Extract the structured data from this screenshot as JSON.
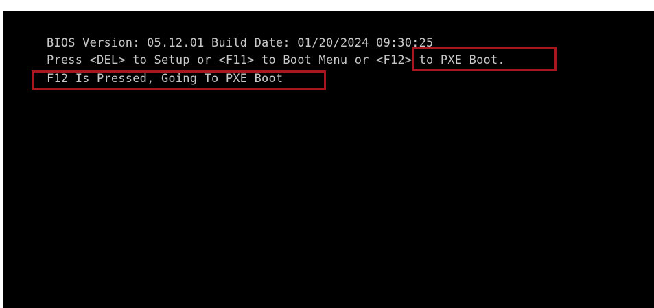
{
  "bios": {
    "line1": "BIOS Version: 05.12.01 Build Date: 01/20/2024 09:30:25",
    "line2_prefix": "Press <DEL> to Setup or <F11> to Boot Menu or ",
    "line2_highlight": "<F12> to PXE Boot",
    "line2_suffix": ".",
    "line3": "F12 Is Pressed, Going To PXE Boot"
  },
  "colors": {
    "background": "#000000",
    "text": "#c9c9c9",
    "highlight_border": "#a8161f"
  }
}
